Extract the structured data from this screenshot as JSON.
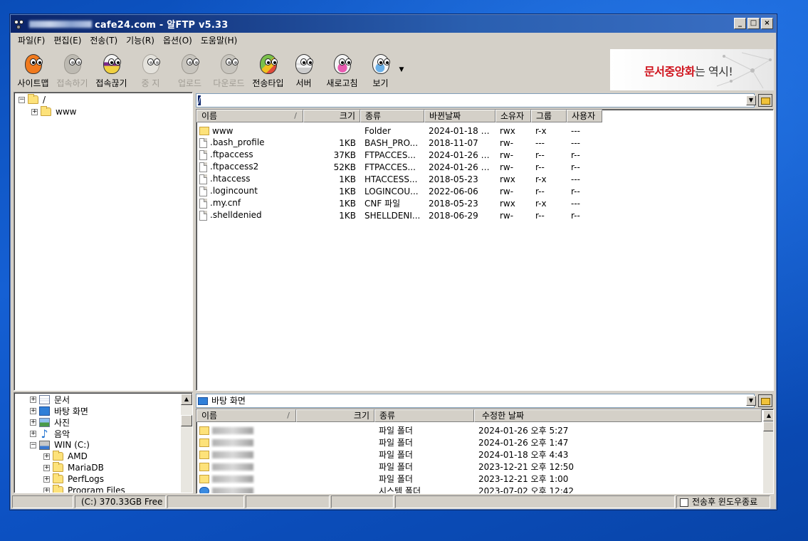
{
  "window": {
    "title": "cafe24.com - 알FTP v5.33",
    "minimize": "_",
    "maximize": "□",
    "close": "×"
  },
  "menu": [
    "파일(F)",
    "편집(E)",
    "전송(T)",
    "기능(R)",
    "옵션(O)",
    "도움말(H)"
  ],
  "toolbar": {
    "buttons": [
      {
        "label": "사이트맵",
        "icon": "sitemap-icon",
        "enabled": true
      },
      {
        "label": "접속하기",
        "icon": "connect-icon",
        "enabled": false
      },
      {
        "label": "접속끊기",
        "icon": "disconnect-icon",
        "enabled": true
      },
      {
        "label": "중 지",
        "icon": "stop-icon",
        "enabled": false
      },
      {
        "label": "업로드",
        "icon": "upload-icon",
        "enabled": false
      },
      {
        "label": "다운로드",
        "icon": "download-icon",
        "enabled": false
      },
      {
        "label": "전송타입",
        "icon": "transfer-type-icon",
        "enabled": true
      },
      {
        "label": "서버",
        "icon": "server-icon",
        "enabled": true
      },
      {
        "label": "새로고침",
        "icon": "refresh-icon",
        "enabled": true
      },
      {
        "label": "보기",
        "icon": "view-icon",
        "enabled": true
      }
    ],
    "more_arrow": "▼"
  },
  "ad": {
    "text_red": "문서중앙화",
    "text_gray": "는 역시!"
  },
  "remote": {
    "tree": {
      "root": "/",
      "children": [
        "www"
      ]
    },
    "path": "/",
    "columns": [
      "이름",
      "크기",
      "종류",
      "바뀐날짜",
      "소유자",
      "그룹",
      "사용자"
    ],
    "sort_mark": "/",
    "files": [
      {
        "name": "www",
        "size": "",
        "type": "Folder",
        "date": "2024-01-18 오...",
        "owner": "rwx",
        "group": "r-x",
        "user": "---",
        "folder": true
      },
      {
        "name": ".bash_profile",
        "size": "1KB",
        "type": "BASH_PRO...",
        "date": "2018-11-07",
        "owner": "rw-",
        "group": "---",
        "user": "---",
        "folder": false
      },
      {
        "name": ".ftpaccess",
        "size": "37KB",
        "type": "FTPACCES...",
        "date": "2024-01-26 오...",
        "owner": "rw-",
        "group": "r--",
        "user": "r--",
        "folder": false
      },
      {
        "name": ".ftpaccess2",
        "size": "52KB",
        "type": "FTPACCES...",
        "date": "2024-01-26 오...",
        "owner": "rw-",
        "group": "r--",
        "user": "r--",
        "folder": false
      },
      {
        "name": ".htaccess",
        "size": "1KB",
        "type": "HTACCESS...",
        "date": "2018-05-23",
        "owner": "rwx",
        "group": "r-x",
        "user": "---",
        "folder": false
      },
      {
        "name": ".logincount",
        "size": "1KB",
        "type": "LOGINCOU...",
        "date": "2022-06-06",
        "owner": "rw-",
        "group": "r--",
        "user": "r--",
        "folder": false
      },
      {
        "name": ".my.cnf",
        "size": "1KB",
        "type": "CNF 파일",
        "date": "2018-05-23",
        "owner": "rwx",
        "group": "r-x",
        "user": "---",
        "folder": false
      },
      {
        "name": ".shelldenied",
        "size": "1KB",
        "type": "SHELLDENI...",
        "date": "2018-06-29",
        "owner": "rw-",
        "group": "r--",
        "user": "r--",
        "folder": false
      }
    ]
  },
  "local": {
    "tree": [
      {
        "label": "문서",
        "icon": "documents-icon",
        "indent": 0
      },
      {
        "label": "바탕 화면",
        "icon": "desktop-icon",
        "indent": 0
      },
      {
        "label": "사진",
        "icon": "pictures-icon",
        "indent": 0
      },
      {
        "label": "음악",
        "icon": "music-icon",
        "indent": 0
      },
      {
        "label": "WIN (C:)",
        "icon": "drive-icon",
        "indent": 0
      },
      {
        "label": "AMD",
        "icon": "folder-icon",
        "indent": 1
      },
      {
        "label": "MariaDB",
        "icon": "folder-icon",
        "indent": 1
      },
      {
        "label": "PerfLogs",
        "icon": "folder-icon",
        "indent": 1
      },
      {
        "label": "Program Files",
        "icon": "folder-icon",
        "indent": 1
      }
    ],
    "path": "바탕 화면",
    "columns": [
      "이름",
      "크기",
      "종류",
      "수정한 날짜"
    ],
    "sort_mark": "/",
    "files": [
      {
        "type": "파일 폴더",
        "date": "2024-01-26 오후 5:27"
      },
      {
        "type": "파일 폴더",
        "date": "2024-01-26 오후 1:47"
      },
      {
        "type": "파일 폴더",
        "date": "2024-01-18 오후 4:43"
      },
      {
        "type": "파일 폴더",
        "date": "2023-12-21 오후 12:50"
      },
      {
        "type": "파일 폴더",
        "date": "2023-12-21 오후 1:00"
      },
      {
        "type": "시스템 폴더",
        "date": "2023-07-02 오후 12:42"
      }
    ]
  },
  "status": {
    "drive": "(C:)  370.33GB Free",
    "close_after_transfer": "전송후 윈도우종료"
  },
  "colors": {
    "titlebar": "#0a246a",
    "ad_red": "#d0141e",
    "desktop": "#1560d4"
  }
}
